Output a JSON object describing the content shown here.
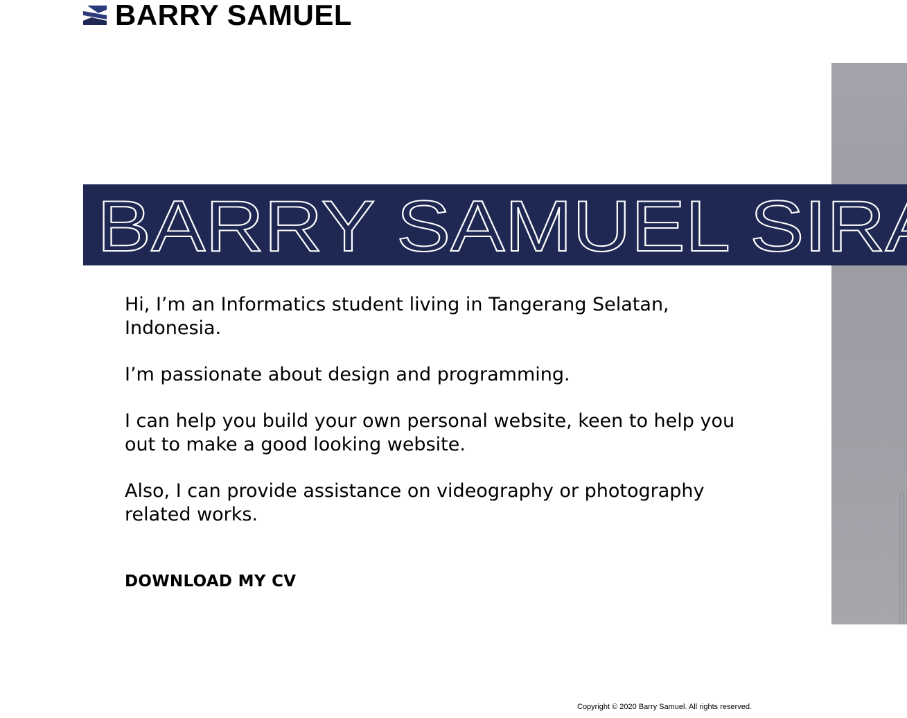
{
  "header": {
    "logo_text": "BARRY SAMUEL"
  },
  "hero": {
    "banner_text": "BARRY SAMUEL SIRAIT",
    "banner_color": "#1f2853"
  },
  "about": {
    "paragraphs": [
      "Hi, I’m an Informatics student living in Tangerang Selatan, Indonesia.",
      "I’m passionate about design and programming.",
      "I can help you build your own personal website, keen to help you out to make a good looking website.",
      "Also, I can provide assistance on videography or photography related works."
    ]
  },
  "cta": {
    "download_cv_label": "DOWNLOAD MY CV"
  },
  "footer": {
    "copyright": "Copyright © 2020 Barry Samuel. All rights reserved."
  },
  "colors": {
    "accent_navy": "#1f2853",
    "photo_gray": "#a0a0a8"
  },
  "icons": {
    "logo_mark": "s-logo-icon"
  }
}
